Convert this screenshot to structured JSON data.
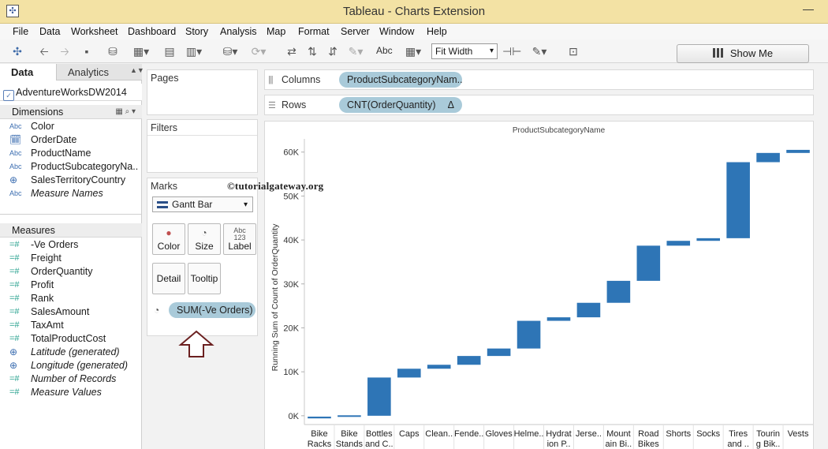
{
  "window": {
    "title": "Tableau - Charts Extension",
    "minimize": "—"
  },
  "menu": [
    "File",
    "Data",
    "Worksheet",
    "Dashboard",
    "Story",
    "Analysis",
    "Map",
    "Format",
    "Server",
    "Window",
    "Help"
  ],
  "toolbar": {
    "fit_mode": "Fit Width",
    "label_text": "Abc",
    "show_me": "Show Me"
  },
  "data_pane": {
    "tabs": [
      "Data",
      "Analytics"
    ],
    "datasource": "AdventureWorksDW2014",
    "dimensions_header": "Dimensions",
    "dimensions": [
      {
        "type": "Abc",
        "name": "Color",
        "italic": false
      },
      {
        "type": "cal",
        "name": "OrderDate",
        "italic": false
      },
      {
        "type": "Abc",
        "name": "ProductName",
        "italic": false
      },
      {
        "type": "Abc",
        "name": "ProductSubcategoryNa..",
        "italic": false
      },
      {
        "type": "globe",
        "name": "SalesTerritoryCountry",
        "italic": false
      },
      {
        "type": "Abc",
        "name": "Measure Names",
        "italic": true
      }
    ],
    "measures_header": "Measures",
    "measures": [
      {
        "type": "#",
        "name": "-Ve Orders",
        "italic": false
      },
      {
        "type": "#",
        "name": "Freight",
        "italic": false
      },
      {
        "type": "#",
        "name": "OrderQuantity",
        "italic": false
      },
      {
        "type": "#",
        "name": "Profit",
        "italic": false
      },
      {
        "type": "#",
        "name": "Rank",
        "italic": false
      },
      {
        "type": "#",
        "name": "SalesAmount",
        "italic": false
      },
      {
        "type": "#",
        "name": "TaxAmt",
        "italic": false
      },
      {
        "type": "#",
        "name": "TotalProductCost",
        "italic": false
      },
      {
        "type": "globe",
        "name": "Latitude (generated)",
        "italic": true
      },
      {
        "type": "globe",
        "name": "Longitude (generated)",
        "italic": true
      },
      {
        "type": "#",
        "name": "Number of Records",
        "italic": true
      },
      {
        "type": "#",
        "name": "Measure Values",
        "italic": true
      }
    ]
  },
  "cards": {
    "pages": "Pages",
    "filters": "Filters",
    "marks": "Marks",
    "mark_type": "Gantt Bar",
    "buttons": {
      "color": "Color",
      "size": "Size",
      "label": "Label",
      "label_pic": "Abc\n123",
      "detail": "Detail",
      "tooltip": "Tooltip"
    },
    "size_pill": "SUM(-Ve Orders)"
  },
  "shelves": {
    "columns_label": "Columns",
    "columns_pill": "ProductSubcategoryNam..",
    "rows_label": "Rows",
    "rows_pill": "CNT(OrderQuantity)",
    "rows_delta": "Δ"
  },
  "watermark": "©tutorialgateway.org",
  "colors": {
    "bar": "#2e75b6",
    "pill": "#a9cad9",
    "titlebar": "#f3e2a4"
  },
  "chart_data": {
    "type": "gantt",
    "title": "ProductSubcategoryName",
    "ylabel": "Running Sum of Count of OrderQuantity",
    "ylim": [
      -2000,
      63000
    ],
    "yticks": [
      "0K",
      "10K",
      "20K",
      "30K",
      "40K",
      "50K",
      "60K"
    ],
    "categories": [
      "Bike\nRacks",
      "Bike\nStands",
      "Bottles\nand C..",
      "Caps",
      "Clean..",
      "Fende..",
      "Gloves",
      "Helme..",
      "Hydrat\nion P..",
      "Jerse..",
      "Mount\nain Bi..",
      "Road\nBikes",
      "Shorts",
      "Socks",
      "Tires\nand ..",
      "Tourin\ng Bik..",
      "Vests"
    ],
    "start": [
      -600,
      -100,
      0,
      8700,
      10700,
      11600,
      13600,
      15300,
      21600,
      22400,
      25700,
      30700,
      38700,
      39800,
      40400,
      57700,
      59800
    ],
    "end": [
      -200,
      100,
      8700,
      10700,
      11600,
      13600,
      15300,
      21600,
      22400,
      25700,
      30700,
      38700,
      39800,
      40400,
      57700,
      59800,
      60500
    ]
  }
}
